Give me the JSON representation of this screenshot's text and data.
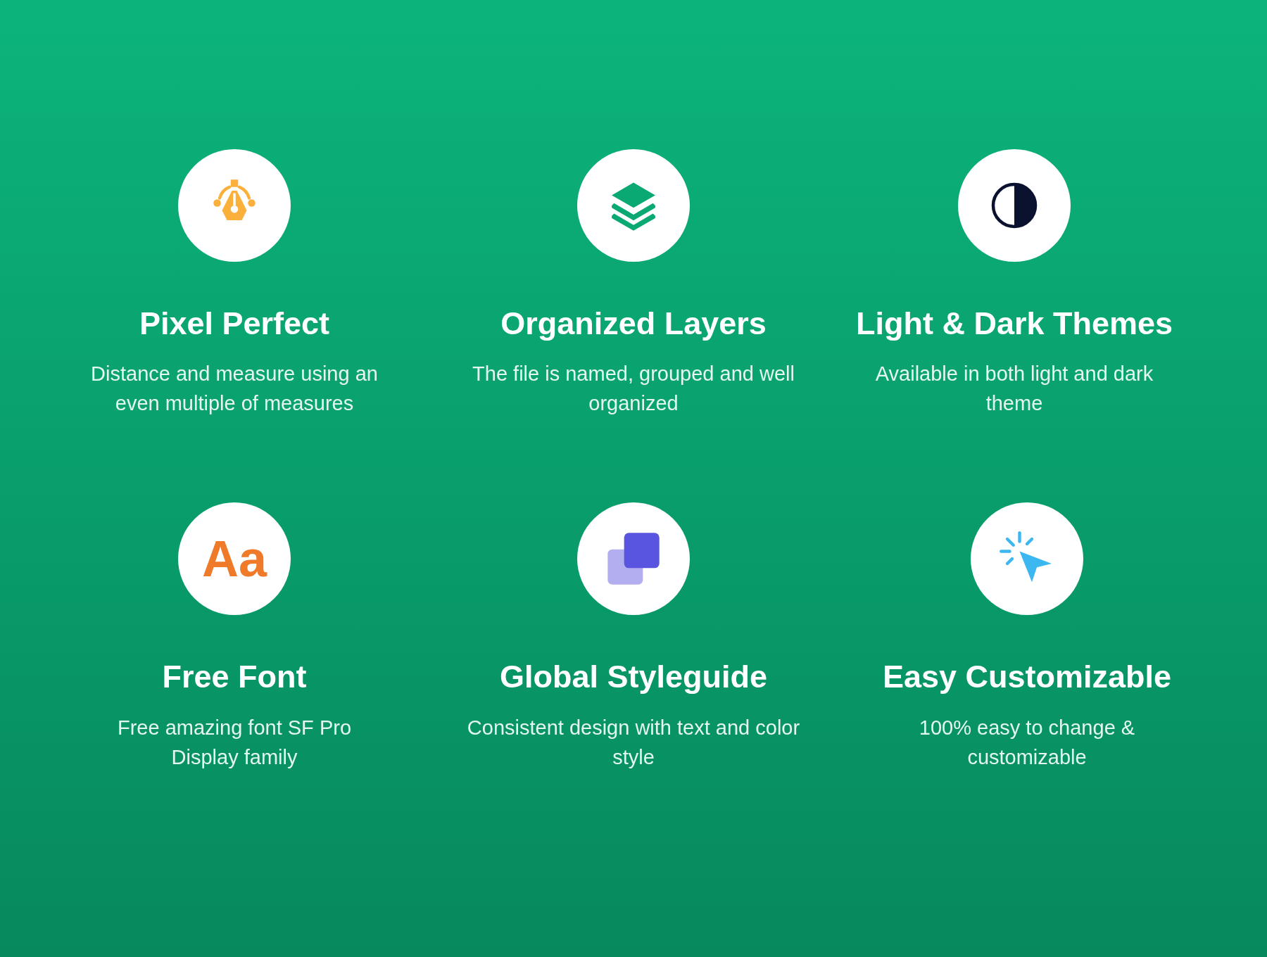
{
  "features": [
    {
      "kind": "pen",
      "title": "Pixel Perfect",
      "description": "Distance and measure using an even multiple of measures"
    },
    {
      "kind": "layers",
      "title": "Organized Layers",
      "description": "The file is named, grouped and well organized"
    },
    {
      "kind": "contrast",
      "title": "Light & Dark Themes",
      "description": "Available in both light and dark theme"
    },
    {
      "kind": "font",
      "icon_text": "Aa",
      "title": "Free Font",
      "description": "Free amazing font SF Pro Display family"
    },
    {
      "kind": "squares",
      "title": "Global Styleguide",
      "description": "Consistent design with text and color style"
    },
    {
      "kind": "cursor",
      "title": "Easy Customizable",
      "description": "100% easy to change & customizable"
    }
  ]
}
